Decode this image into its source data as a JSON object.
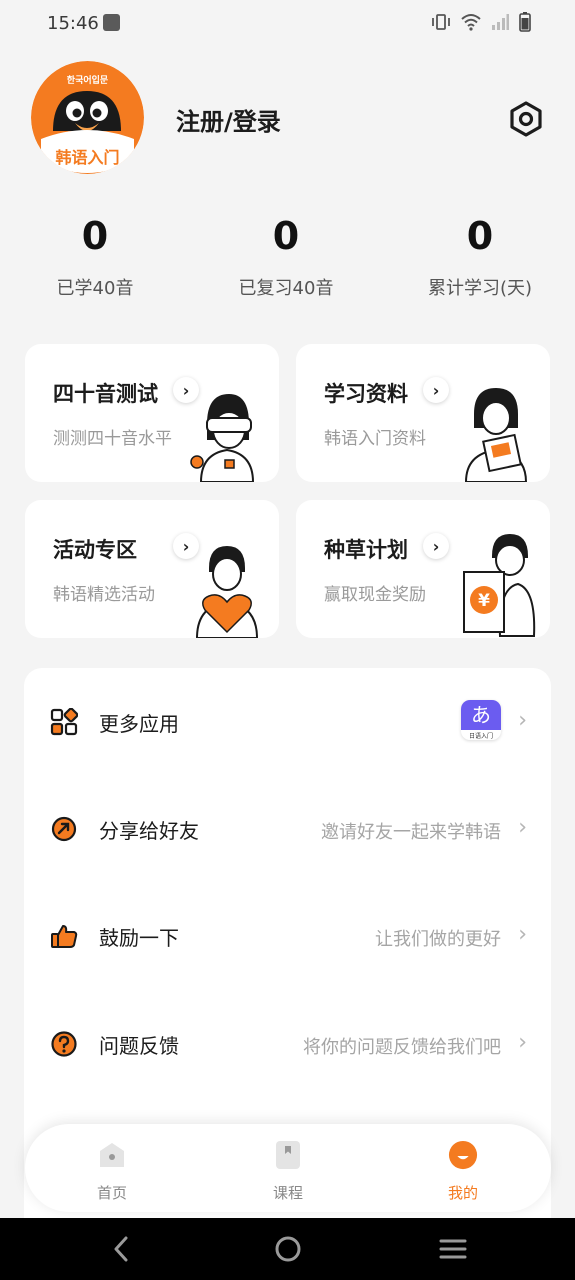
{
  "status_bar": {
    "time": "15:46",
    "icons": [
      "notification-icon",
      "vibrate-icon",
      "wifi-icon",
      "signal-icon",
      "battery-icon"
    ]
  },
  "profile": {
    "avatar_text": "韩语入门",
    "avatar_korean": "한국어입문",
    "login_label": "注册/登录"
  },
  "stats": [
    {
      "value": "0",
      "label": "已学40音"
    },
    {
      "value": "0",
      "label": "已复习40音"
    },
    {
      "value": "0",
      "label": "累计学习(天)"
    }
  ],
  "cards": [
    {
      "title": "四十音测试",
      "subtitle": "测测四十音水平"
    },
    {
      "title": "学习资料",
      "subtitle": "韩语入门资料"
    },
    {
      "title": "活动专区",
      "subtitle": "韩语精选活动"
    },
    {
      "title": "种草计划",
      "subtitle": "赢取现金奖励"
    }
  ],
  "card_ill": {
    "currency": "¥"
  },
  "menu": [
    {
      "label": "更多应用",
      "hint": "",
      "badge_glyph": "あ",
      "badge_text": "日语入门"
    },
    {
      "label": "分享给好友",
      "hint": "邀请好友一起来学韩语"
    },
    {
      "label": "鼓励一下",
      "hint": "让我们做的更好"
    },
    {
      "label": "问题反馈",
      "hint": "将你的问题反馈给我们吧"
    }
  ],
  "tabs": [
    {
      "label": "首页",
      "active": false
    },
    {
      "label": "课程",
      "active": false
    },
    {
      "label": "我的",
      "active": true
    }
  ],
  "colors": {
    "accent": "#f47b20",
    "background": "#f4f4f4",
    "card": "#ffffff",
    "text_primary": "#1c1c1c",
    "text_secondary": "#9a9a9a"
  }
}
